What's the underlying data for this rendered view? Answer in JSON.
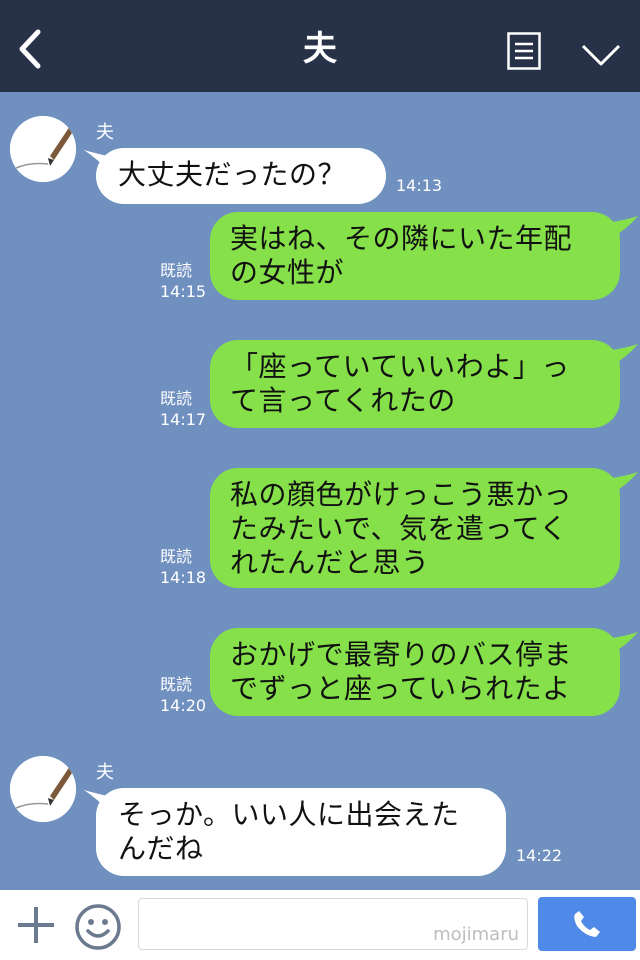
{
  "header": {
    "title": "夫"
  },
  "messages": [
    {
      "side": "in",
      "sender": "夫",
      "lines": [
        "大丈夫だったの？"
      ],
      "time": "14:13"
    },
    {
      "side": "out",
      "read": "既読",
      "lines": [
        "実はね、その隣にいた年配",
        "の女性が"
      ],
      "time": "14:15"
    },
    {
      "side": "out",
      "read": "既読",
      "lines": [
        "「座っていていいわよ」っ",
        "て言ってくれたの"
      ],
      "time": "14:17"
    },
    {
      "side": "out",
      "read": "既読",
      "lines": [
        "私の顔色がけっこう悪かっ",
        "たみたいで、気を遣ってく",
        "れたんだと思う"
      ],
      "time": "14:18"
    },
    {
      "side": "out",
      "read": "既読",
      "lines": [
        "おかげで最寄りのバス停ま",
        "でずっと座っていられたよ"
      ],
      "time": "14:20"
    },
    {
      "side": "in",
      "sender": "夫",
      "lines": [
        "そっか。いい人に出会えた",
        "んだね"
      ],
      "time": "14:22"
    }
  ],
  "input": {
    "watermark": "mojimaru"
  },
  "colors": {
    "background": "#7090c0",
    "header": "#273147",
    "bubble_out": "#85e049",
    "bubble_in": "#ffffff",
    "send": "#4f8ae8"
  },
  "icons": {
    "back": "chevron-left-icon",
    "menu": "notes-icon",
    "collapse": "chevron-down-icon",
    "plus": "plus-icon",
    "sticker": "smiley-icon",
    "call": "phone-icon"
  }
}
